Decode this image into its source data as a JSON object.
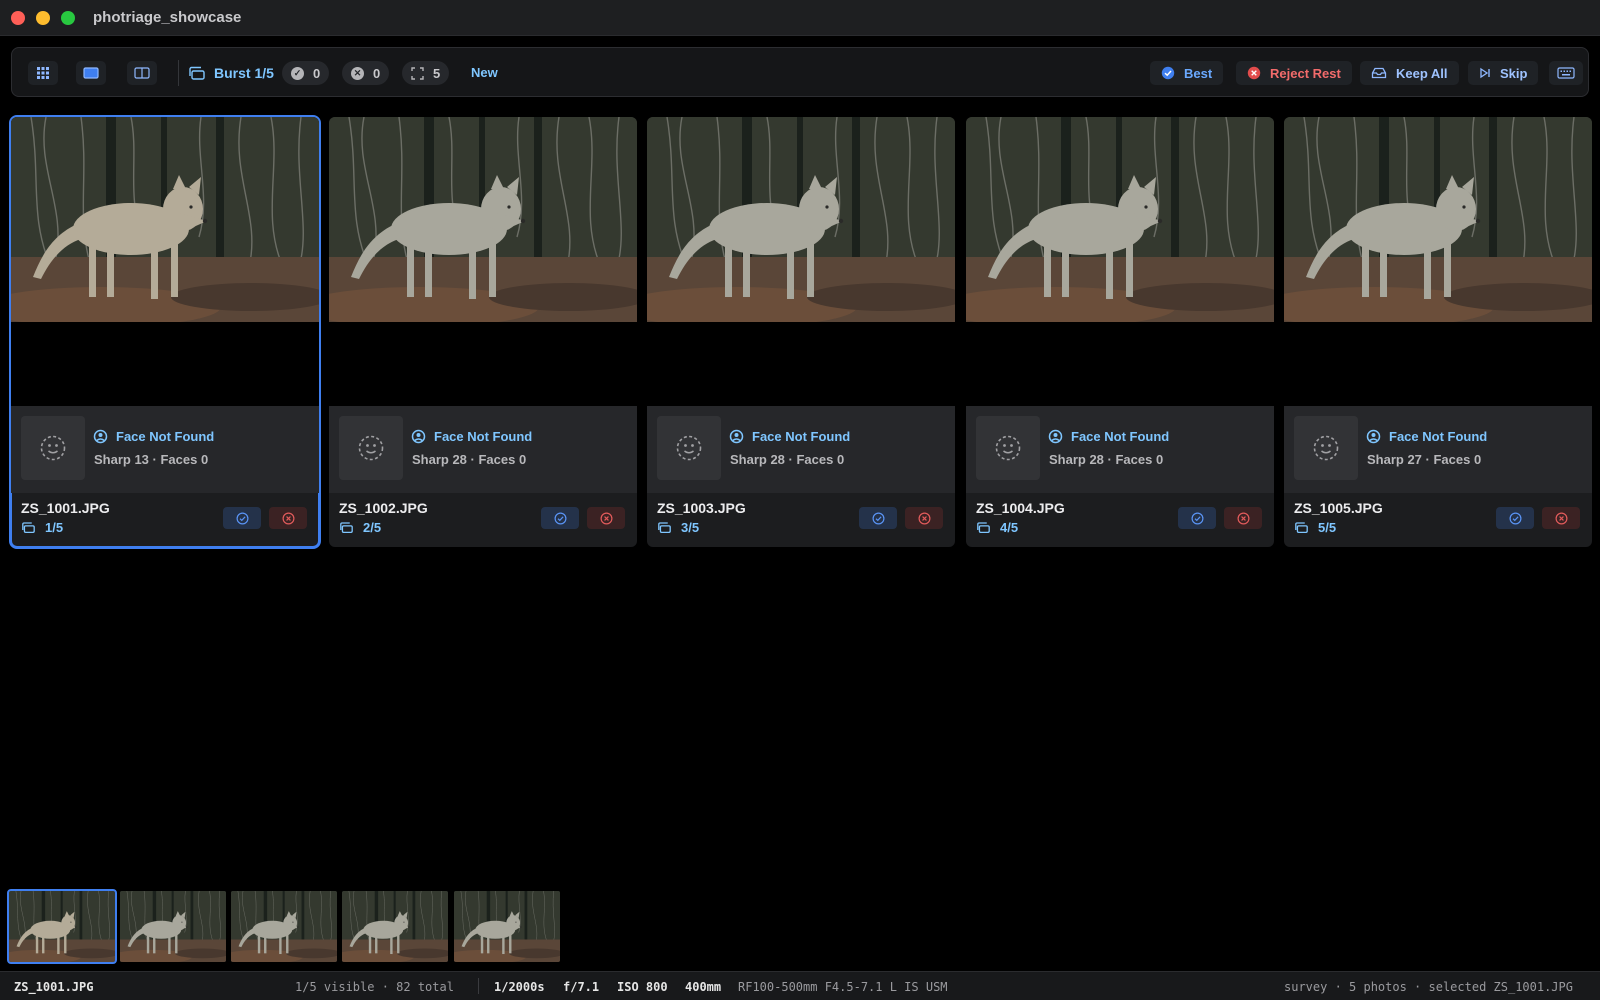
{
  "window": {
    "title": "photriage_showcase"
  },
  "toolbar": {
    "view_buttons": [
      "grid-view",
      "single-view",
      "compare-view"
    ],
    "burst_label": "Burst 1/5",
    "counts": {
      "accepted": "0",
      "rejected": "0",
      "focus": "5"
    },
    "new_label": "New",
    "best_label": "Best",
    "reject_rest_label": "Reject Rest",
    "keep_all_label": "Keep All",
    "skip_label": "Skip",
    "accent": "#3f7ff0"
  },
  "cards": [
    {
      "filename": "ZS_1001.JPG",
      "face_status": "Face Not Found",
      "meta": "Sharp 13 · Faces 0",
      "burst_index": "1/5",
      "selected": true
    },
    {
      "filename": "ZS_1002.JPG",
      "face_status": "Face Not Found",
      "meta": "Sharp 28 · Faces 0",
      "burst_index": "2/5",
      "selected": false
    },
    {
      "filename": "ZS_1003.JPG",
      "face_status": "Face Not Found",
      "meta": "Sharp 28 · Faces 0",
      "burst_index": "3/5",
      "selected": false
    },
    {
      "filename": "ZS_1004.JPG",
      "face_status": "Face Not Found",
      "meta": "Sharp 28 · Faces 0",
      "burst_index": "4/5",
      "selected": false
    },
    {
      "filename": "ZS_1005.JPG",
      "face_status": "Face Not Found",
      "meta": "Sharp 27 · Faces 0",
      "burst_index": "5/5",
      "selected": false
    }
  ],
  "statusbar": {
    "filename": "ZS_1001.JPG",
    "visible": "1/5 visible · 82 total",
    "shutter": "1/2000s",
    "aperture": "f/7.1",
    "iso": "ISO 800",
    "focal": "400mm",
    "lens": "RF100-500mm F4.5-7.1 L IS USM",
    "summary": "survey · 5 photos · selected ZS_1001.JPG"
  }
}
